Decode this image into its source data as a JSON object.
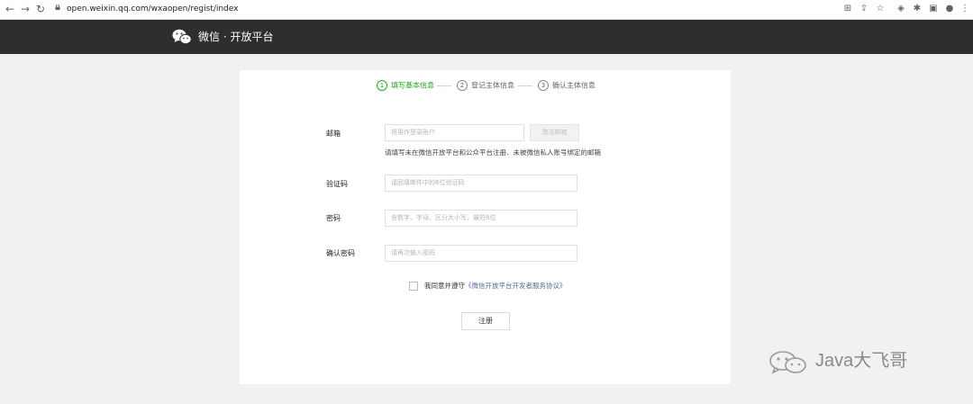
{
  "browser": {
    "url": "open.weixin.qq.com/wxaopen/regist/index"
  },
  "header": {
    "title": "微信 · 开放平台"
  },
  "steps": [
    {
      "num": "1",
      "label": "填写基本信息"
    },
    {
      "num": "2",
      "label": "登记主体信息"
    },
    {
      "num": "3",
      "label": "确认主体信息"
    }
  ],
  "form": {
    "email_label": "邮箱",
    "email_placeholder": "将用作登录账户",
    "send_button": "激活邮箱",
    "email_hint": "请填写未在微信开放平台和公众平台注册、未被微信私人账号绑定的邮箱",
    "code_label": "验证码",
    "code_placeholder": "请回填邮件中的6位验证码",
    "password_label": "密码",
    "password_placeholder": "含数字、字母、区分大小写，最短8位",
    "confirm_label": "确认密码",
    "confirm_placeholder": "请再次输入密码",
    "agree_text": "我同意并遵守",
    "agree_link": "《微信开放平台开发者服务协议》",
    "submit": "注册"
  },
  "watermark": {
    "text": "Java大飞哥"
  },
  "colors": {
    "active_step": "#1aad19",
    "header_bg": "#2e2e2e",
    "link": "#576b95"
  }
}
